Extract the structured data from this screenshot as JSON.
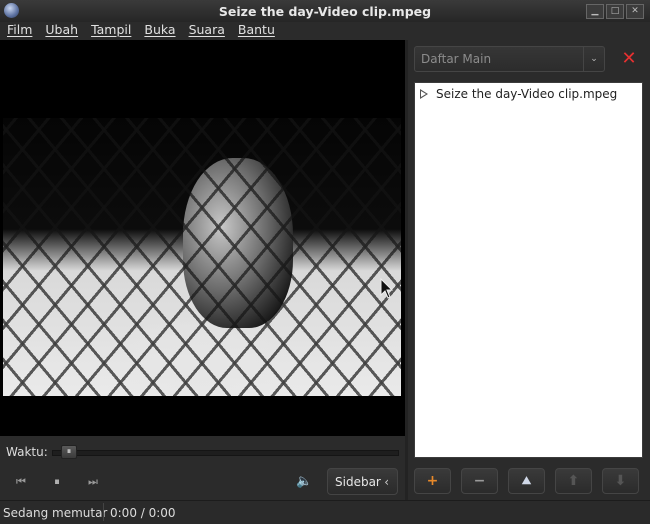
{
  "window": {
    "title": "Seize the day-Video clip.mpeg",
    "controls": [
      "minimize-icon",
      "maximize-icon",
      "close-icon"
    ]
  },
  "menu": [
    "Film",
    "Ubah",
    "Tampil",
    "Buka",
    "Suara",
    "Bantu"
  ],
  "seek": {
    "label": "Waktu:",
    "position_fraction": 0.04
  },
  "controls": {
    "previous_icon": "skip-back-icon",
    "pause_icon": "pause-icon",
    "next_icon": "skip-forward-icon",
    "volume_icon": "speaker-icon",
    "sidebar_label": "Sidebar",
    "sidebar_mnemonic_char": "i"
  },
  "sidebar": {
    "selector_label": "Daftar Main",
    "close_icon": "close-x-icon",
    "playlist": [
      {
        "title": "Seize the day-Video clip.mpeg",
        "playing": true
      }
    ],
    "buttons": [
      {
        "name": "add-button",
        "icon": "plus-icon",
        "enabled": true,
        "color": "#e8892a"
      },
      {
        "name": "remove-button",
        "icon": "minus-icon",
        "enabled": true,
        "color": "#9a9a9a"
      },
      {
        "name": "save-button",
        "icon": "save-playlist-icon",
        "enabled": true,
        "color": "#d0d8e8"
      },
      {
        "name": "move-up-button",
        "icon": "arrow-up-icon",
        "enabled": false,
        "color": "#555555"
      },
      {
        "name": "move-down-button",
        "icon": "arrow-down-icon",
        "enabled": false,
        "color": "#555555"
      }
    ]
  },
  "status": {
    "state": "Sedang memutar",
    "time": "0:00 / 0:00"
  }
}
